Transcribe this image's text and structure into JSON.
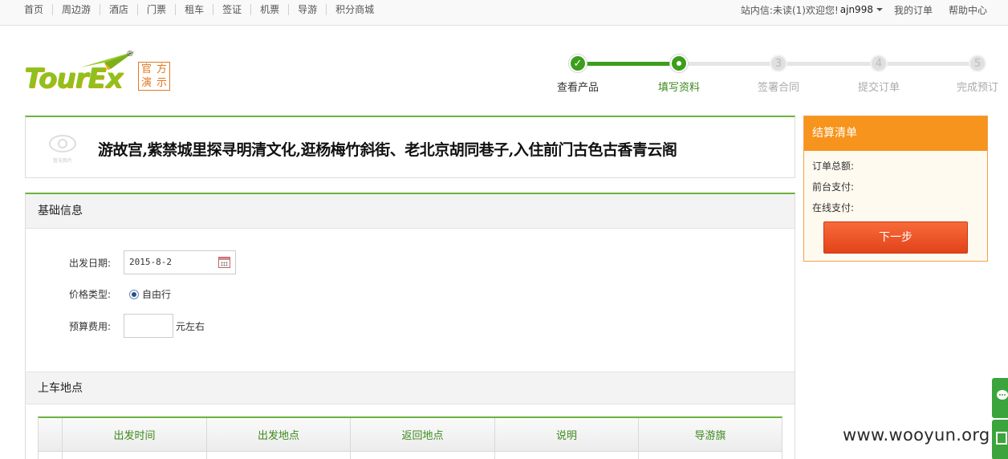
{
  "top_nav": {
    "items": [
      "首页",
      "周边游",
      "酒店",
      "门票",
      "租车",
      "签证",
      "机票",
      "导游",
      "积分商城"
    ],
    "message": "站内信:未读(1)欢迎您!",
    "username": "ajn998",
    "my_orders": "我的订单",
    "help": "帮助中心"
  },
  "logo": {
    "text": "TourEx",
    "badge": [
      "官",
      "方",
      "演",
      "示"
    ],
    "registered": "®"
  },
  "steps": [
    {
      "num": "✓",
      "label": "查看产品",
      "state": "done"
    },
    {
      "num": "",
      "label": "填写资料",
      "state": "current"
    },
    {
      "num": "3",
      "label": "签署合同",
      "state": "todo"
    },
    {
      "num": "4",
      "label": "提交订单",
      "state": "todo"
    },
    {
      "num": "5",
      "label": "完成预订",
      "state": "todo"
    }
  ],
  "product": {
    "title": "游故宫,紫禁城里探寻明清文化,逛杨梅竹斜街、老北京胡同巷子,入住前门古色古香青云阁",
    "thumb_caption": "暂无图片"
  },
  "basic_info": {
    "heading": "基础信息",
    "depart_label": "出发日期:",
    "depart_value": "2015-8-2",
    "price_type_label": "价格类型:",
    "price_type_option": "自由行",
    "budget_label": "预算费用:",
    "budget_value": "",
    "budget_unit": "元左右"
  },
  "pickup": {
    "heading": "上车地点",
    "columns": [
      "",
      "出发时间",
      "出发地点",
      "返回地点",
      "说明",
      "导游旗"
    ]
  },
  "summary": {
    "heading": "结算清单",
    "order_total": "订单总额:",
    "front_pay": "前台支付:",
    "online_pay": "在线支付:",
    "next": "下一步"
  },
  "watermark": "www.wooyun.org",
  "colors": {
    "brand_green": "#3c9e1c",
    "accent_orange": "#f7941d",
    "button_red": "#e2431a"
  }
}
